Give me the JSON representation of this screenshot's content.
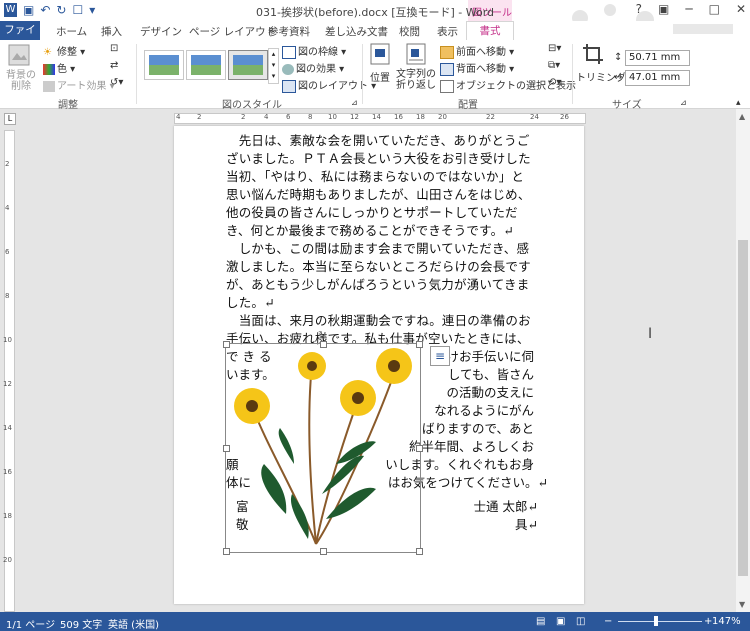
{
  "app": {
    "title": "031-挨拶状(before).docx [互換モード] - Word",
    "context_tab_group": "図ツール",
    "window_controls": [
      "?",
      "□",
      "─",
      "□",
      "✕"
    ]
  },
  "tabs": {
    "file": "ファイル",
    "items": [
      "ホーム",
      "挿入",
      "デザイン",
      "ページ レイアウト",
      "参考資料",
      "差し込み文書",
      "校閲",
      "表示"
    ],
    "format": "書式"
  },
  "ribbon": {
    "adjust": {
      "label": "調整",
      "remove_bg": "背景の\n削除",
      "corrections": "修整",
      "color": "色",
      "artistic": "アート効果"
    },
    "styles": {
      "label": "図のスタイル",
      "border": "図の枠線",
      "effects": "図の効果",
      "layout": "図のレイアウト"
    },
    "arrange": {
      "label": "配置",
      "position": "位置",
      "wrap": "文字列の\n折り返し",
      "forward": "前面へ移動",
      "backward": "背面へ移動",
      "selection": "オブジェクトの選択と表示"
    },
    "size": {
      "label": "サイズ",
      "crop": "トリミング",
      "height": "50.71 mm",
      "width": "47.01 mm"
    }
  },
  "ruler": {
    "top_numbers": [
      "4",
      "2",
      "2",
      "4",
      "6",
      "8",
      "10",
      "12",
      "14",
      "16",
      "18",
      "20",
      "22",
      "24",
      "26"
    ],
    "left_numbers": [
      "2",
      "4",
      "6",
      "8",
      "10",
      "12",
      "14",
      "16",
      "18",
      "20"
    ]
  },
  "document": {
    "lines": [
      "　先日は、素敵な会を開いていただき、ありがとうご",
      "ざいました。ＰＴＡ会長という大役をお引き受けした",
      "当初、「やはり、私には務まらないのではないか」と",
      "思い悩んだ時期もありましたが、山田さんをはじめ、",
      "他の役員の皆さんにしっかりとサポートしていただ",
      "き、何とか最後まで務めることができそうです。↵",
      "　しかも、この間は励ます会まで開いていただき、感",
      "激しました。本当に至らないところだらけの会長です",
      "が、あともう少しがんばろうという気力が湧いてきま",
      "した。↵",
      "　当面は、来月の秋期運動会ですね。連日の準備のお",
      "手伝い、お疲れ様です。私も仕事が空いたときには、"
    ],
    "wrap_left": [
      "で き る",
      "います。"
    ],
    "wrap_right": [
      "だけお手伝いに伺",
      "しても、皆さん",
      "の活動の支えに",
      "なれるようにがん",
      "ばりますので、あと",
      "約半年間、よろしくお",
      "いします。くれぐれもお身",
      "はお気をつけてください。↵"
    ],
    "left_fragments": [
      "願",
      "体に"
    ],
    "closing_left": [
      "富",
      "敬"
    ],
    "closing_right": [
      "士通 太郎↵",
      "具↵"
    ]
  },
  "status": {
    "page": "1/1 ページ",
    "words": "509 文字",
    "language": "英語 (米国)",
    "zoom": "147%"
  }
}
